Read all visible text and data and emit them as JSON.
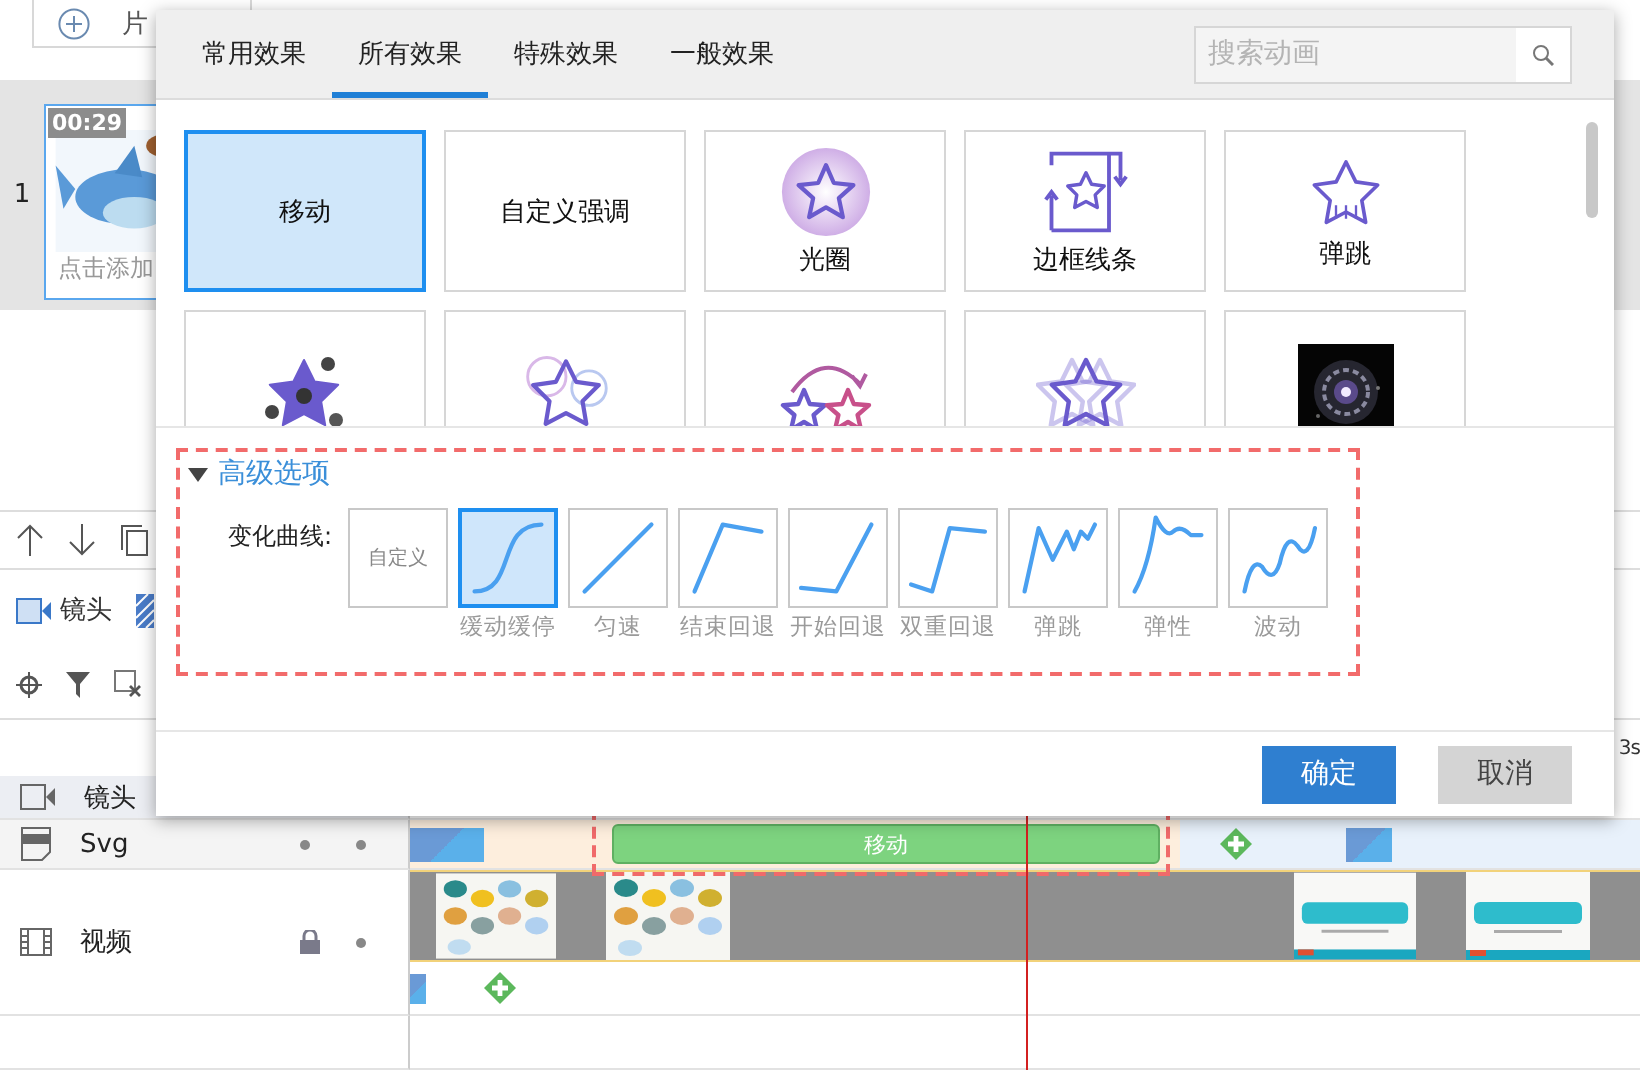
{
  "add_button": {
    "label": "片"
  },
  "slides": [
    {
      "number": "1",
      "duration": "00:29",
      "caption": "点击添加",
      "selected": true
    }
  ],
  "camera_tool": {
    "label": "镜头"
  },
  "ruler": {
    "time": "3s"
  },
  "tracks": [
    {
      "name": "镜头",
      "kind": "camera"
    },
    {
      "name": "Svg",
      "kind": "svg",
      "locked": false
    },
    {
      "name": "视频",
      "kind": "video",
      "locked": true
    }
  ],
  "clip": {
    "label": "移动"
  },
  "dialog": {
    "tabs": [
      {
        "label": "常用效果",
        "selected": false
      },
      {
        "label": "所有效果",
        "selected": true
      },
      {
        "label": "特殊效果",
        "selected": false
      },
      {
        "label": "一般效果",
        "selected": false
      }
    ],
    "search": {
      "placeholder": "搜索动画"
    },
    "effects": [
      {
        "kind": "text",
        "label": "移动",
        "selected": true
      },
      {
        "kind": "text",
        "label": "自定义强调",
        "selected": false
      },
      {
        "kind": "glow",
        "label": "光圈",
        "selected": false
      },
      {
        "kind": "frame",
        "label": "边框线条",
        "selected": false
      },
      {
        "kind": "bounce",
        "label": "弹跳",
        "selected": false
      },
      {
        "kind": "bullet",
        "selected": false
      },
      {
        "kind": "ring",
        "selected": false
      },
      {
        "kind": "arc",
        "selected": false
      },
      {
        "kind": "stack",
        "selected": false
      },
      {
        "kind": "picture",
        "selected": false
      }
    ],
    "advanced": {
      "title": "高级选项",
      "expanded": true,
      "curve_label": "变化曲线:",
      "curves": [
        {
          "kind": "custom",
          "tile_text": "自定义",
          "selected": false
        },
        {
          "kind": "ease",
          "label": "缓动缓停",
          "selected": true
        },
        {
          "kind": "linear",
          "label": "匀速",
          "selected": false
        },
        {
          "kind": "end-back",
          "label": "结束回退",
          "selected": false
        },
        {
          "kind": "start-back",
          "label": "开始回退",
          "selected": false
        },
        {
          "kind": "double-back",
          "label": "双重回退",
          "selected": false
        },
        {
          "kind": "bounce",
          "label": "弹跳",
          "selected": false
        },
        {
          "kind": "elastic",
          "label": "弹性",
          "selected": false
        },
        {
          "kind": "wave",
          "label": "波动",
          "selected": false
        }
      ]
    },
    "buttons": [
      {
        "label": "确定",
        "kind": "primary"
      },
      {
        "label": "取消",
        "kind": "secondary"
      }
    ]
  }
}
